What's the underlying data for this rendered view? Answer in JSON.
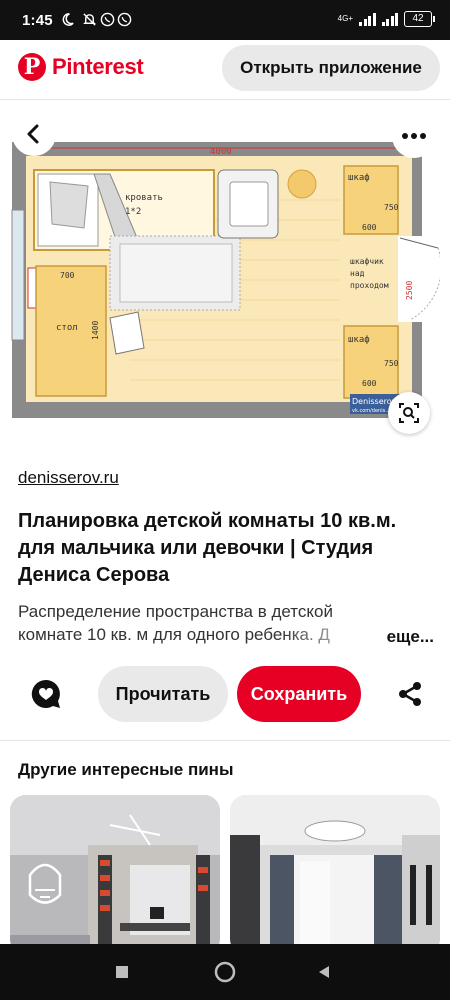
{
  "status_bar": {
    "time": "1:45",
    "network": "4G+",
    "battery": "42"
  },
  "header": {
    "brand": "Pinterest",
    "brand_letter": "P",
    "open_app_label": "Открыть приложение"
  },
  "pin": {
    "floor_plan": {
      "width_label": "4000",
      "height_label": "2500",
      "bed_label": "кровать",
      "bed_size": "1*2",
      "wardrobe_top_label": "шкаф",
      "wardrobe_top_depth": "750",
      "wardrobe_top_width": "600",
      "cabinet_label_1": "шкафчик",
      "cabinet_label_2": "над",
      "cabinet_label_3": "проходом",
      "wardrobe_bottom_label": "шкаф",
      "wardrobe_bottom_depth": "750",
      "wardrobe_bottom_width": "600",
      "desk_label": "стол",
      "desk_width": "700",
      "desk_length": "1400",
      "watermark": "Denisserov",
      "watermark_small": "vk.com/denis..."
    },
    "source": "denisserov.ru",
    "title": "Планировка детской комнаты 10 кв.м. для мальчика или девочки | Студия Дениса Серова",
    "description": "Распределение пространства в детской комнате 10 кв. м для одного ребенка. Д",
    "more_label": "еще..."
  },
  "actions": {
    "read_label": "Прочитать",
    "save_label": "Сохранить"
  },
  "related": {
    "title": "Другие интересные пины"
  },
  "colors": {
    "brand_red": "#e60023",
    "button_gray": "#e9e9e9"
  },
  "icons": {
    "back": "chevron-left-icon",
    "more": "more-dots-icon",
    "lens": "visual-search-icon",
    "comment": "comment-icon",
    "share": "share-icon"
  }
}
